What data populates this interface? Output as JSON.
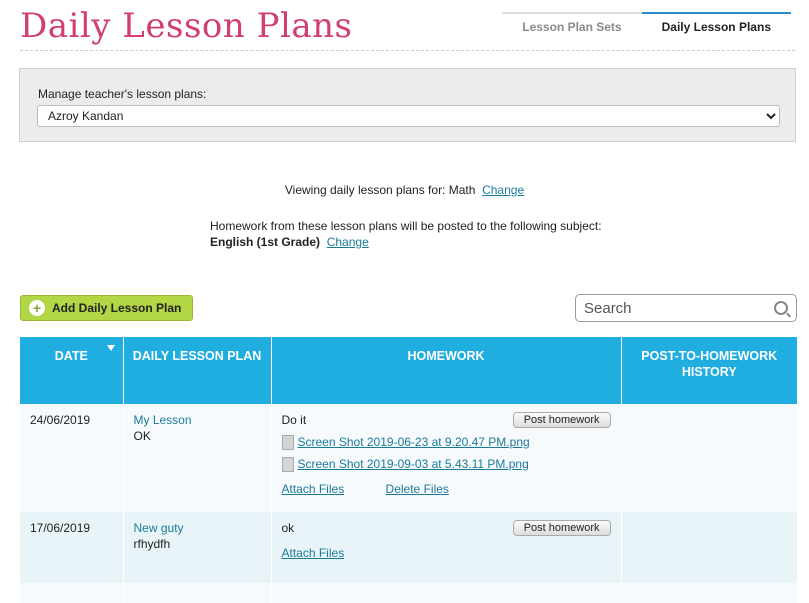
{
  "page": {
    "title": "Daily Lesson Plans"
  },
  "tabs": [
    {
      "label": "Lesson Plan Sets",
      "active": false
    },
    {
      "label": "Daily Lesson Plans",
      "active": true
    }
  ],
  "manage": {
    "label": "Manage teacher's lesson plans:",
    "selected_teacher": "Azroy Kandan"
  },
  "viewing": {
    "text": "Viewing daily lesson plans for: Math",
    "change_label": "Change"
  },
  "homework_info": {
    "line1": "Homework from these lesson plans will be posted to the following subject:",
    "subject": "English (1st Grade)",
    "change_label": "Change"
  },
  "toolbar": {
    "add_label": "Add Daily Lesson Plan",
    "search_placeholder": "Search"
  },
  "table": {
    "headers": [
      "DATE",
      "DAILY LESSON PLAN",
      "HOMEWORK",
      "POST-TO-HOMEWORK HISTORY"
    ],
    "rows": [
      {
        "date": "24/06/2019",
        "lesson": "My Lesson",
        "lesson_note": "OK",
        "homework": "Do it",
        "post_label": "Post homework",
        "files": [
          "Screen Shot 2019-06-23 at 9.20.47 PM.png",
          "Screen Shot 2019-09-03 at 5.43.11 PM.png"
        ],
        "attach_label": "Attach Files",
        "delete_label": "Delete Files"
      },
      {
        "date": "17/06/2019",
        "lesson": "New guty",
        "lesson_note": "rfhydfh",
        "homework": "ok",
        "post_label": "Post homework",
        "attach_label": "Attach Files"
      }
    ]
  },
  "colors": {
    "title": "#d23d74",
    "header_bg": "#20ade0",
    "add_button": "#b3d645",
    "link": "#1b7a9a"
  }
}
